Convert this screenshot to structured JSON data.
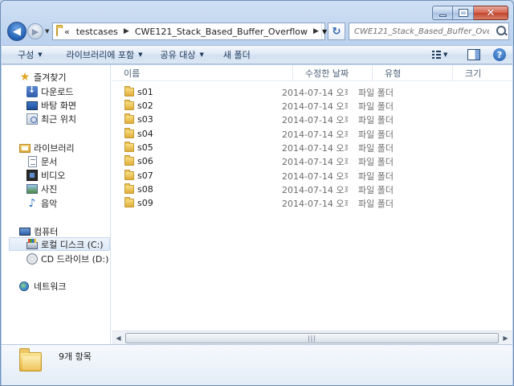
{
  "address": {
    "overflow_glyph": "«",
    "segments": [
      "testcases",
      "CWE121_Stack_Based_Buffer_Overflow"
    ]
  },
  "search": {
    "placeholder": "CWE121_Stack_Based_Buffer_Overflo..."
  },
  "toolbar": {
    "organize": "구성",
    "include_in_library": "라이브러리에 포함",
    "share_with": "공유 대상",
    "new_folder": "새 폴더"
  },
  "nav": {
    "favorites": "즐겨찾기",
    "downloads": "다운로드",
    "desktop": "바탕 화면",
    "recent": "최근 위치",
    "libraries": "라이브러리",
    "documents": "문서",
    "videos": "비디오",
    "pictures": "사진",
    "music": "음악",
    "computer": "컴퓨터",
    "local_disk": "로컬 디스크 (C:)",
    "cd_drive": "CD 드라이브 (D:) V",
    "network": "네트워크"
  },
  "columns": {
    "name": "이름",
    "date": "수정한 날짜",
    "type": "유형",
    "size": "크기"
  },
  "files": [
    {
      "name": "s01",
      "date": "2014-07-14 오후...",
      "type": "파일 폴더"
    },
    {
      "name": "s02",
      "date": "2014-07-14 오후...",
      "type": "파일 폴더"
    },
    {
      "name": "s03",
      "date": "2014-07-14 오후...",
      "type": "파일 폴더"
    },
    {
      "name": "s04",
      "date": "2014-07-14 오후...",
      "type": "파일 폴더"
    },
    {
      "name": "s05",
      "date": "2014-07-14 오후...",
      "type": "파일 폴더"
    },
    {
      "name": "s06",
      "date": "2014-07-14 오후...",
      "type": "파일 폴더"
    },
    {
      "name": "s07",
      "date": "2014-07-14 오후...",
      "type": "파일 폴더"
    },
    {
      "name": "s08",
      "date": "2014-07-14 오후...",
      "type": "파일 폴더"
    },
    {
      "name": "s09",
      "date": "2014-07-14 오후...",
      "type": "파일 폴더"
    }
  ],
  "details": {
    "item_count": "9개 항목"
  }
}
